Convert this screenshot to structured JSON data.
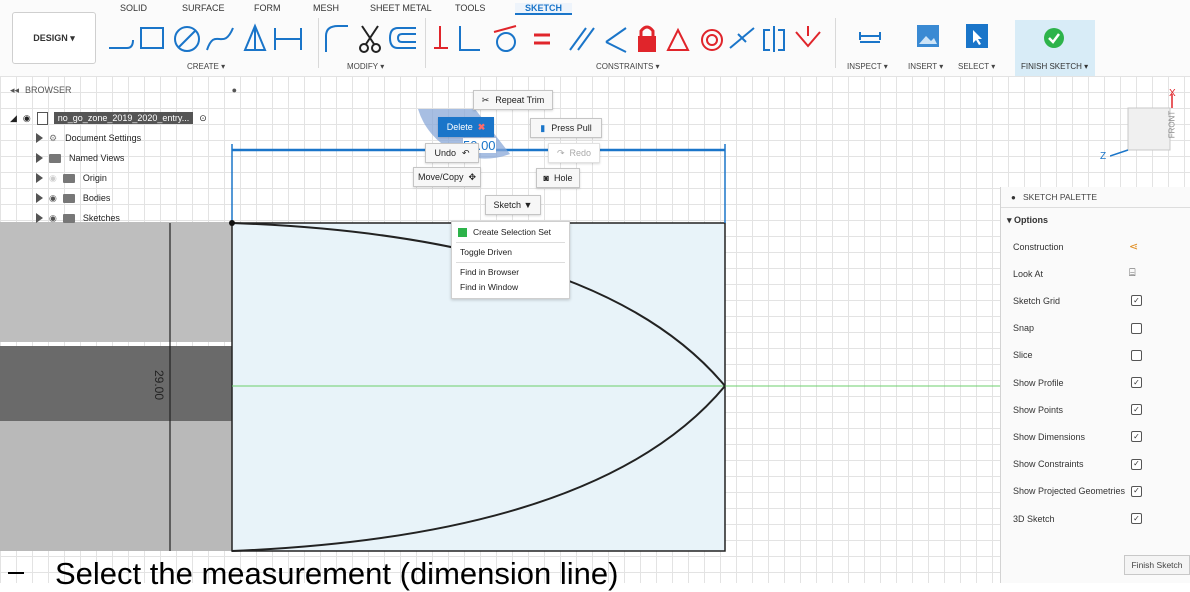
{
  "toolbar": {
    "tabs": [
      "SOLID",
      "SURFACE",
      "FORM",
      "MESH",
      "SHEET METAL",
      "TOOLS",
      "SKETCH"
    ],
    "design_label": "DESIGN ▾",
    "groups": {
      "create": "CREATE ▾",
      "modify": "MODIFY ▾",
      "constraints": "CONSTRAINTS ▾",
      "inspect": "INSPECT ▾",
      "insert": "INSERT ▾",
      "select": "SELECT ▾",
      "finish": "FINISH SKETCH ▾"
    }
  },
  "browser": {
    "header": "BROWSER",
    "root": "no_go_zone_2019_2020_entry...",
    "items": [
      "Document Settings",
      "Named Views",
      "Origin",
      "Bodies",
      "Sketches"
    ]
  },
  "context": {
    "repeat_trim": "Repeat Trim",
    "delete": "Delete",
    "press_pull": "Press Pull",
    "undo": "Undo",
    "redo": "Redo",
    "move_copy": "Move/Copy",
    "hole": "Hole",
    "sketch": "Sketch ▼",
    "menu": [
      "Create Selection Set",
      "Toggle Driven",
      "Find in Browser",
      "Find in Window"
    ]
  },
  "sketch": {
    "dim_horizontal": "50.00",
    "dim_vertical": "29.00"
  },
  "viewcube": {
    "face": "FRONT",
    "axis_x": "X",
    "axis_z": "Z"
  },
  "palette": {
    "title": "SKETCH PALETTE",
    "section": "▾ Options",
    "rows": [
      {
        "label": "Construction",
        "type": "icon"
      },
      {
        "label": "Look At",
        "type": "icon"
      },
      {
        "label": "Sketch Grid",
        "type": "check",
        "checked": true
      },
      {
        "label": "Snap",
        "type": "check",
        "checked": false
      },
      {
        "label": "Slice",
        "type": "check",
        "checked": false
      },
      {
        "label": "Show Profile",
        "type": "check",
        "checked": true
      },
      {
        "label": "Show Points",
        "type": "check",
        "checked": true
      },
      {
        "label": "Show Dimensions",
        "type": "check",
        "checked": true
      },
      {
        "label": "Show Constraints",
        "type": "check",
        "checked": true
      },
      {
        "label": "Show Projected Geometries",
        "type": "check",
        "checked": true
      },
      {
        "label": "3D Sketch",
        "type": "check",
        "checked": true
      }
    ],
    "finish_button": "Finish Sketch"
  },
  "caption": "Select the measurement (dimension line)",
  "colors": {
    "accent": "#1a75c9",
    "constraint_red": "#e0252b",
    "profile_fill": "#e8f3f9",
    "finish_green": "#2db34a"
  }
}
